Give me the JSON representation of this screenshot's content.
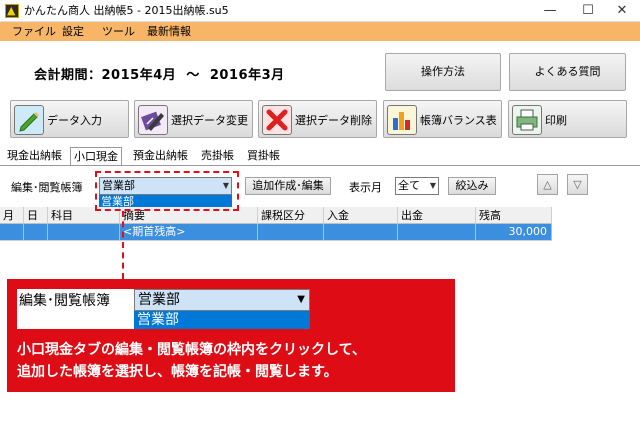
{
  "window": {
    "title": "かんたん商人 出納帳5 - 2015出納帳.su5",
    "minimize": "—",
    "maximize": "☐",
    "close": "✕"
  },
  "menu": [
    "ファイル",
    "設定",
    "ツール",
    "最新情報"
  ],
  "period": {
    "label": "会計期間：",
    "start": "2015年4月",
    "sep": "〜",
    "end": "2016年3月"
  },
  "help_buttons": {
    "howto": "操作方法",
    "faq": "よくある質問"
  },
  "toolbar": {
    "data_entry": "データ入力",
    "edit_selected": "選択データ変更",
    "delete_selected": "選択データ削除",
    "balance_sheet": "帳簿バランス表",
    "print": "印刷"
  },
  "tabs": [
    "現金出納帳",
    "小口現金",
    "預金出納帳",
    "売掛帳",
    "買掛帳"
  ],
  "active_tab": "小口現金",
  "filter": {
    "book_label": "編集･閲覧帳簿",
    "book_value": "営業部",
    "book_option": "営業部",
    "add_button": "追加作成･編集",
    "month_label": "表示月",
    "month_value": "全て",
    "narrow_button": "絞込み",
    "up_button": "△",
    "down_button": "▽"
  },
  "grid": {
    "columns": [
      "月",
      "日",
      "科目",
      "摘要",
      "課税区分",
      "入金",
      "出金",
      "残高"
    ],
    "rows": [
      {
        "description": "<期首残高>",
        "balance": "30,000"
      }
    ]
  },
  "callout": {
    "label": "編集･閲覧帳簿",
    "value": "営業部",
    "option": "営業部",
    "line1": "小口現金タブの編集・閲覧帳簿の枠内をクリックして、",
    "line2": "追加した帳簿を選択し、帳簿を記帳・閲覧します。"
  },
  "colors": {
    "menu_bar": "#f7b567",
    "selection": "#3c8ede",
    "callout": "#dd0c15",
    "highlight_combo": "#cfe3f7"
  }
}
